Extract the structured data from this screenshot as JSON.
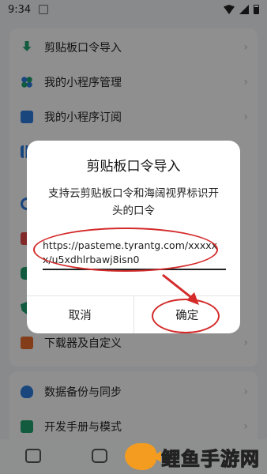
{
  "status_bar": {
    "time": "9:34"
  },
  "menu": {
    "top_items": [
      {
        "label": "剪贴板口令导入",
        "icon": "download-icon"
      },
      {
        "label": "我的小程序管理",
        "icon": "grid-icon"
      },
      {
        "label": "我的小程序订阅",
        "icon": "subscribe-icon"
      },
      {
        "label": "",
        "icon": "chart-icon"
      },
      {
        "label": "",
        "icon": "ring-icon"
      },
      {
        "label": "",
        "icon": "video-icon"
      },
      {
        "label": "",
        "icon": "puzzle-icon"
      },
      {
        "label": "",
        "icon": "shield-icon"
      },
      {
        "label": "下载器及自定义",
        "icon": "downloader-icon"
      }
    ],
    "bottom_items": [
      {
        "label": "数据备份与同步",
        "icon": "cloud-icon"
      },
      {
        "label": "开发手册与模式",
        "icon": "book-icon"
      }
    ]
  },
  "dialog": {
    "title": "剪贴板口令导入",
    "description": "支持云剪贴板口令和海阔视界标识开头的口令",
    "input_value": "https://pasteme.tyrantg.com/xxxxxx/u5xdhlrbawj8isn0",
    "cancel_label": "取消",
    "confirm_label": "确定"
  },
  "annotation": {
    "color": "#d42a2a"
  },
  "watermark": {
    "brand": "鲤鱼手游网"
  }
}
